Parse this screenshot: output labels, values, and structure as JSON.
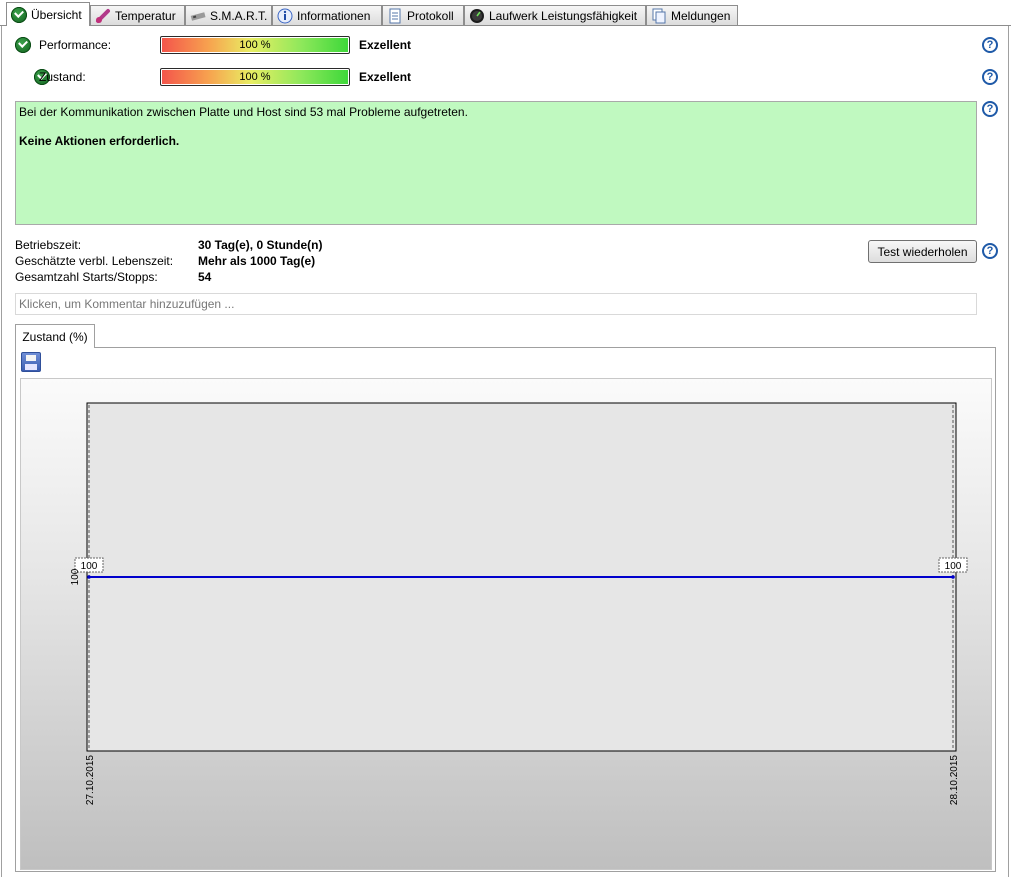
{
  "tabs": [
    {
      "label": "Übersicht",
      "icon": "green-check-icon",
      "active": true
    },
    {
      "label": "Temperatur",
      "icon": "thermometer-icon"
    },
    {
      "label": "S.M.A.R.T.",
      "icon": "smart-chip-icon"
    },
    {
      "label": "Informationen",
      "icon": "info-icon"
    },
    {
      "label": "Protokoll",
      "icon": "document-icon"
    },
    {
      "label": "Laufwerk Leistungsfähigkeit",
      "icon": "gauge-icon"
    },
    {
      "label": "Meldungen",
      "icon": "messages-icon"
    }
  ],
  "status": {
    "performance": {
      "label": "Performance:",
      "percent_text": "100 %",
      "value_pct": 100,
      "rating": "Exzellent"
    },
    "zustand": {
      "label": "Zustand:",
      "percent_text": "100 %",
      "value_pct": 100,
      "rating": "Exzellent"
    }
  },
  "message": {
    "line1": "Bei der Kommunikation zwischen Platte und Host sind 53 mal Probleme aufgetreten.",
    "line2": "Keine Aktionen erforderlich.",
    "background": "#c0f9c0"
  },
  "stats": [
    {
      "label": "Betriebszeit:",
      "value": "30 Tag(e), 0 Stunde(n)"
    },
    {
      "label": "Geschätzte verbl. Lebenszeit:",
      "value": "Mehr als 1000 Tag(e)"
    },
    {
      "label": "Gesamtzahl Starts/Stopps:",
      "value": "54"
    }
  ],
  "test_button": "Test wiederholen",
  "comment_placeholder": "Klicken, um Kommentar hinzuzufügen ...",
  "chart_tab": "Zustand (%)",
  "chart_data": {
    "type": "line",
    "x": [
      "27.10.2015",
      "28.10.2015"
    ],
    "series": [
      {
        "values": [
          100,
          100
        ],
        "color": "#0000cc"
      }
    ],
    "point_labels": [
      "100",
      "100"
    ],
    "y_tick_labels": [
      "100"
    ],
    "x_tick_labels": [
      "27.10.2015",
      "28.10.2015"
    ],
    "ylim": [
      100,
      100
    ],
    "grid": false
  },
  "colors": {
    "help": "#1f5aa8",
    "line": "#0000cc"
  }
}
